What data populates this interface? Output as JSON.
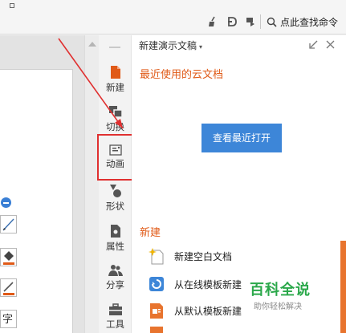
{
  "toolbar": {
    "icons": [
      "broom-icon",
      "d-icon",
      "flag-icon",
      "search-icon"
    ],
    "search_label": "点此查找命令"
  },
  "tabs": [
    {
      "name": "tab-new",
      "label": "新建",
      "icon": "document-icon"
    },
    {
      "name": "tab-transition",
      "label": "切换",
      "icon": "transition-icon"
    },
    {
      "name": "tab-animation",
      "label": "动画",
      "icon": "animation-icon"
    },
    {
      "name": "tab-shape",
      "label": "形状",
      "icon": "shape-icon"
    },
    {
      "name": "tab-properties",
      "label": "属性",
      "icon": "properties-icon"
    },
    {
      "name": "tab-share",
      "label": "分享",
      "icon": "share-icon"
    },
    {
      "name": "tab-tools",
      "label": "工具",
      "icon": "toolbox-icon"
    }
  ],
  "left_tools": {
    "bottom_char": "字"
  },
  "panel": {
    "title": "新建演示文稿",
    "caret": "▾",
    "recent_heading": "最近使用的云文档",
    "view_recent_button": "查看最近打开",
    "new_heading": "新建",
    "new_items": [
      {
        "label": "新建空白文档",
        "icon": "sparkle-doc-icon"
      },
      {
        "label": "从在线模板新建",
        "icon": "online-template-icon"
      },
      {
        "label": "从默认模板新建",
        "icon": "default-template-icon"
      }
    ]
  },
  "watermark": {
    "main": "百科全说",
    "sub": "助你轻松解决"
  },
  "colors": {
    "accent_orange": "#e05a17",
    "button_blue": "#3d86d8",
    "highlight_red": "#e03030",
    "watermark_green": "#2aa84a"
  }
}
